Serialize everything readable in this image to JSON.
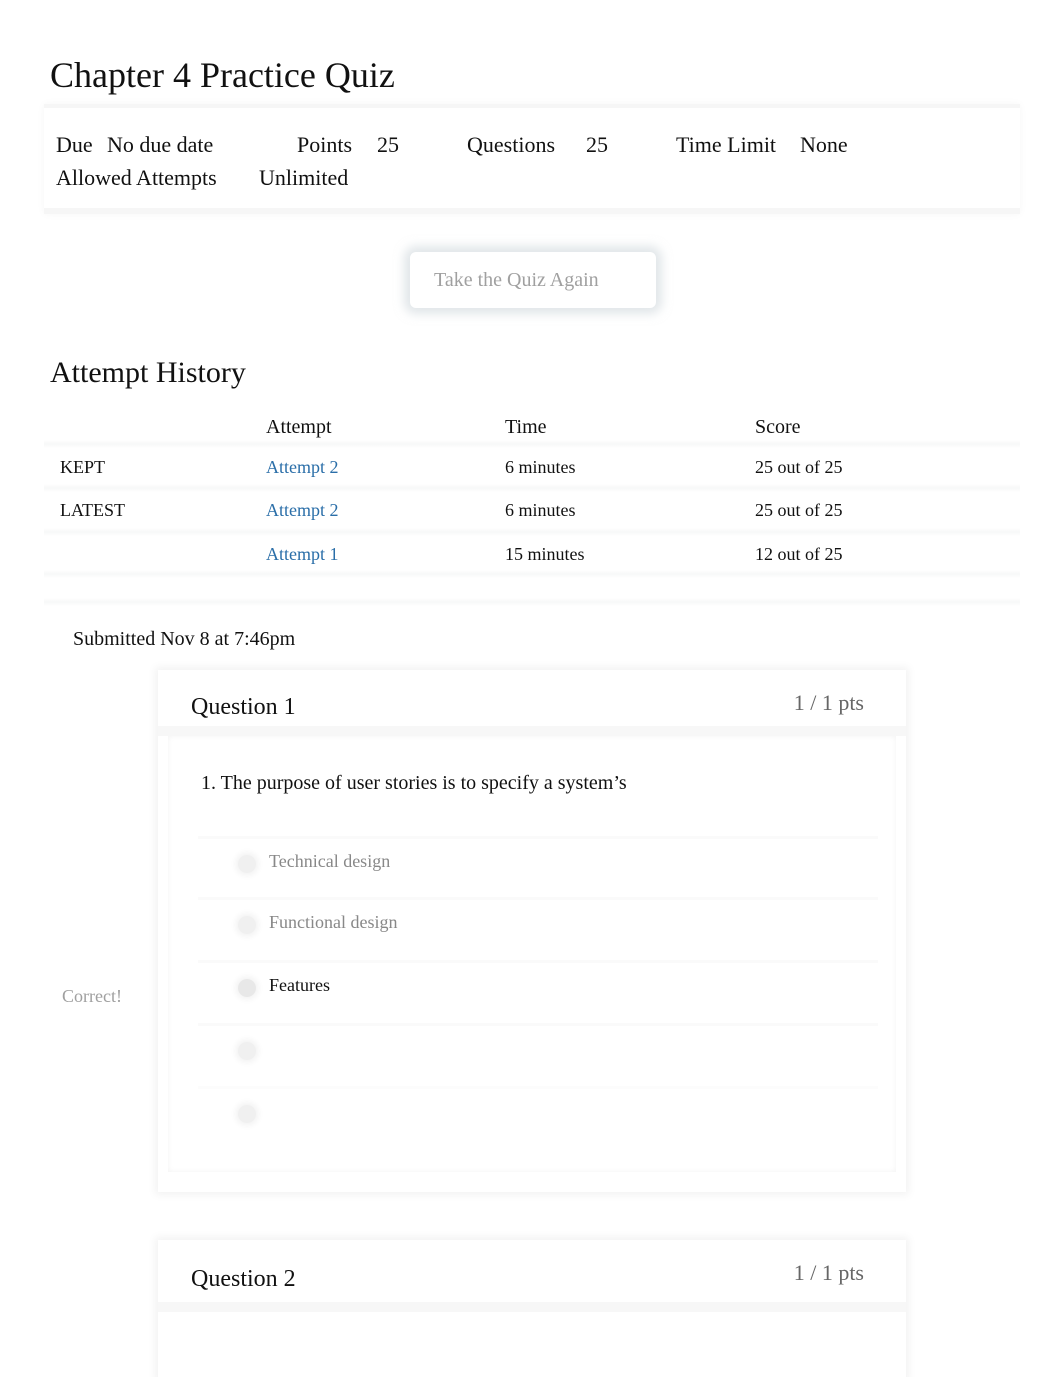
{
  "page": {
    "title": "Chapter 4 Practice Quiz"
  },
  "details": {
    "due_label": "Due",
    "due_value": "No due date",
    "points_label": "Points",
    "points_value": "25",
    "questions_label": "Questions",
    "questions_value": "25",
    "time_limit_label": "Time Limit",
    "time_limit_value": "None",
    "attempts_label": "Allowed Attempts",
    "attempts_value": "Unlimited"
  },
  "actions": {
    "take_again_label": "Take the Quiz Again"
  },
  "history": {
    "title": "Attempt History",
    "columns": [
      "",
      "Attempt",
      "Time",
      "Score"
    ],
    "rows": [
      {
        "tag": "KEPT",
        "attempt": "Attempt 2",
        "time": "6 minutes",
        "score": "25 out of 25"
      },
      {
        "tag": "LATEST",
        "attempt": "Attempt 2",
        "time": "6 minutes",
        "score": "25 out of 25"
      },
      {
        "tag": "",
        "attempt": "Attempt 1",
        "time": "15 minutes",
        "score": "12 out of 25"
      }
    ]
  },
  "submission": {
    "submitted_text": "Submitted Nov 8 at 7:46pm"
  },
  "questions": [
    {
      "name": "Question 1",
      "points": "1 / 1 pts",
      "text": "1. The purpose of user stories is to specify a system’s",
      "result_label": "Correct!",
      "answers": [
        {
          "label": "Technical design",
          "selected": false
        },
        {
          "label": "Functional design",
          "selected": false
        },
        {
          "label": "Features",
          "selected": true
        },
        {
          "label": "",
          "selected": false
        },
        {
          "label": "",
          "selected": false
        }
      ]
    },
    {
      "name": "Question 2",
      "points": "1 / 1 pts"
    }
  ],
  "colors": {
    "link": "#2a6ea8",
    "muted_text": "#888888",
    "correct_label": "#a0a0a0"
  }
}
